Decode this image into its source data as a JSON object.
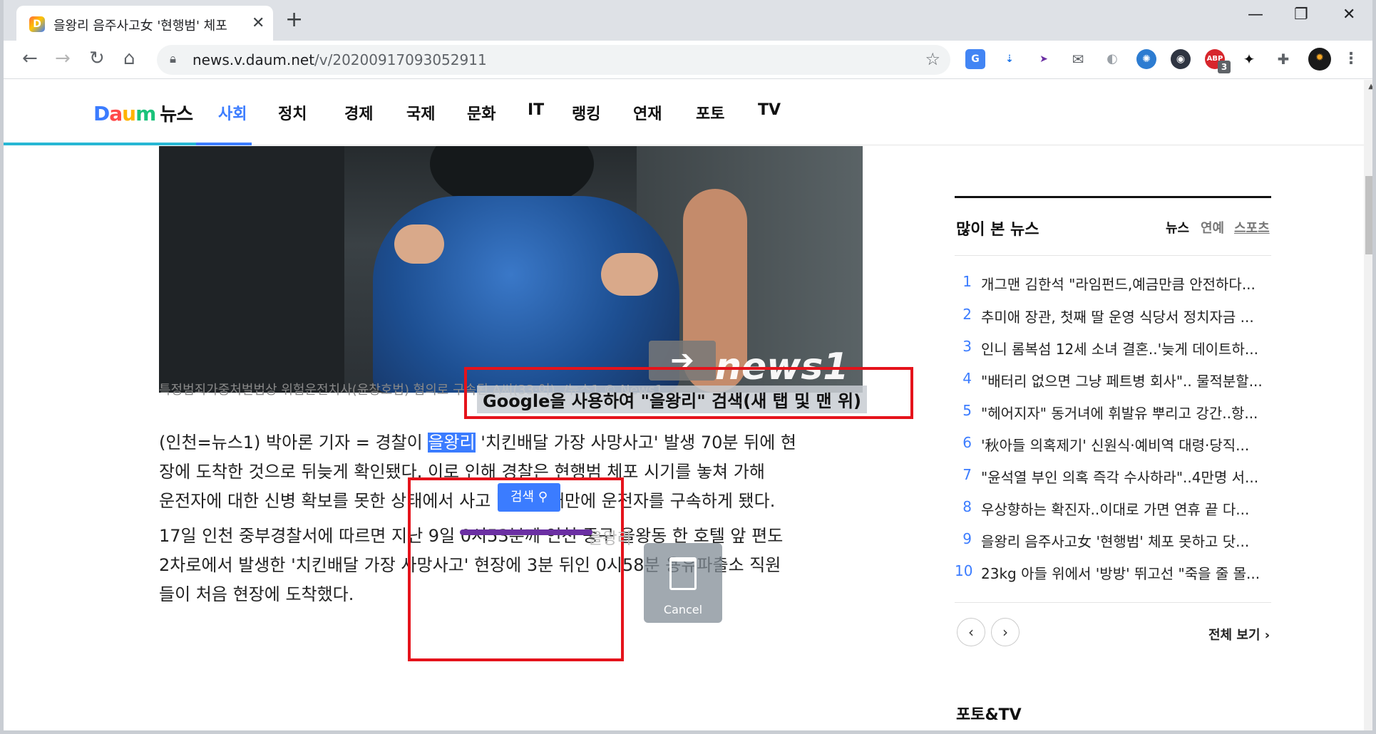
{
  "browser": {
    "tab_title": "을왕리 음주사고女 '현행범' 체포",
    "tab_favicon": "D",
    "url_host": "news.v.daum.net",
    "url_path": "/v/20200917093052911",
    "extension_badge": "3"
  },
  "site": {
    "logo_letters": [
      "D",
      "a",
      "u",
      "m"
    ],
    "logo_news": "뉴스",
    "menu": [
      "사회",
      "정치",
      "경제",
      "국제",
      "문화",
      "IT",
      "랭킹",
      "연재",
      "포토",
      "TV"
    ]
  },
  "article": {
    "photo_watermark": "news1",
    "caption": "특정범죄가중처벌법상 위험운전치사(윤창호법) 혐의로 구속된 A씨(33·여). /뉴스1 © News1",
    "p1_line1_before": "(인천=뉴스1) 박아론 기자 = 경찰이 ",
    "p1_line1_highlight": "을왕리",
    "p1_line1_after": " '치킨배달 가장 사망사고' 발생 70분 뒤에 현",
    "p1_line2": "장에 도착한 것으로 뒤늦게 확인됐다. 이로 인해 경찰은 현행범 체포 시기를 놓쳐 가해",
    "p1_line3": "운전자에 대한 신병 확보를 못한 상태에서 사고 발생 닷새만에 운전자를 구속하게 됐다.",
    "p2_line1": "17일 인천 중부경찰서에 따르면 지난 9일 0시53분께 인천 중구 을왕동 한 호텔 앞 편도",
    "p2_line2": "2차로에서 발생한 '치킨배달 가장 사망사고' 현장에 3분 뒤인 0시58분 용유파출소 직원",
    "p2_line3": "들이 처음 현장에 도착했다."
  },
  "gesture": {
    "arrow": "➔",
    "label": "Google을 사용하여 \"을왕리\" 검색(새 탭 및 맨 위)",
    "search_button": "검색",
    "drag_text": "을왕리",
    "cancel": "Cancel"
  },
  "sidebar": {
    "title": "많이 본 뉴스",
    "tabs": [
      "뉴스",
      "연예",
      "스포츠"
    ],
    "items": [
      {
        "rank": "1",
        "title": "개그맨 김한석 \"라임펀드,예금만큼 안전하다..."
      },
      {
        "rank": "2",
        "title": "추미애 장관, 첫째 딸 운영 식당서 정치자금 ..."
      },
      {
        "rank": "3",
        "title": "인니 롬복섬 12세 소녀 결혼..'늦게 데이트하..."
      },
      {
        "rank": "4",
        "title": "\"배터리 없으면 그냥 페트병 회사\".. 물적분할..."
      },
      {
        "rank": "5",
        "title": "\"헤어지자\" 동거녀에 휘발유 뿌리고 강간..항..."
      },
      {
        "rank": "6",
        "title": "'秋아들 의혹제기' 신원식·예비역 대령·당직..."
      },
      {
        "rank": "7",
        "title": "\"윤석열 부인 의혹 즉각 수사하라\"..4만명 서..."
      },
      {
        "rank": "8",
        "title": "우상향하는 확진자..이대로 가면 연휴 끝 다..."
      },
      {
        "rank": "9",
        "title": "을왕리 음주사고女 '현행범' 체포 못하고 닷..."
      },
      {
        "rank": "10",
        "title": "23kg 아들 위에서 '방방' 뛰고선 \"죽을 줄 몰..."
      }
    ],
    "prev": "‹",
    "next": "›",
    "more": "전체 보기 ›",
    "section2": "포토&TV"
  }
}
